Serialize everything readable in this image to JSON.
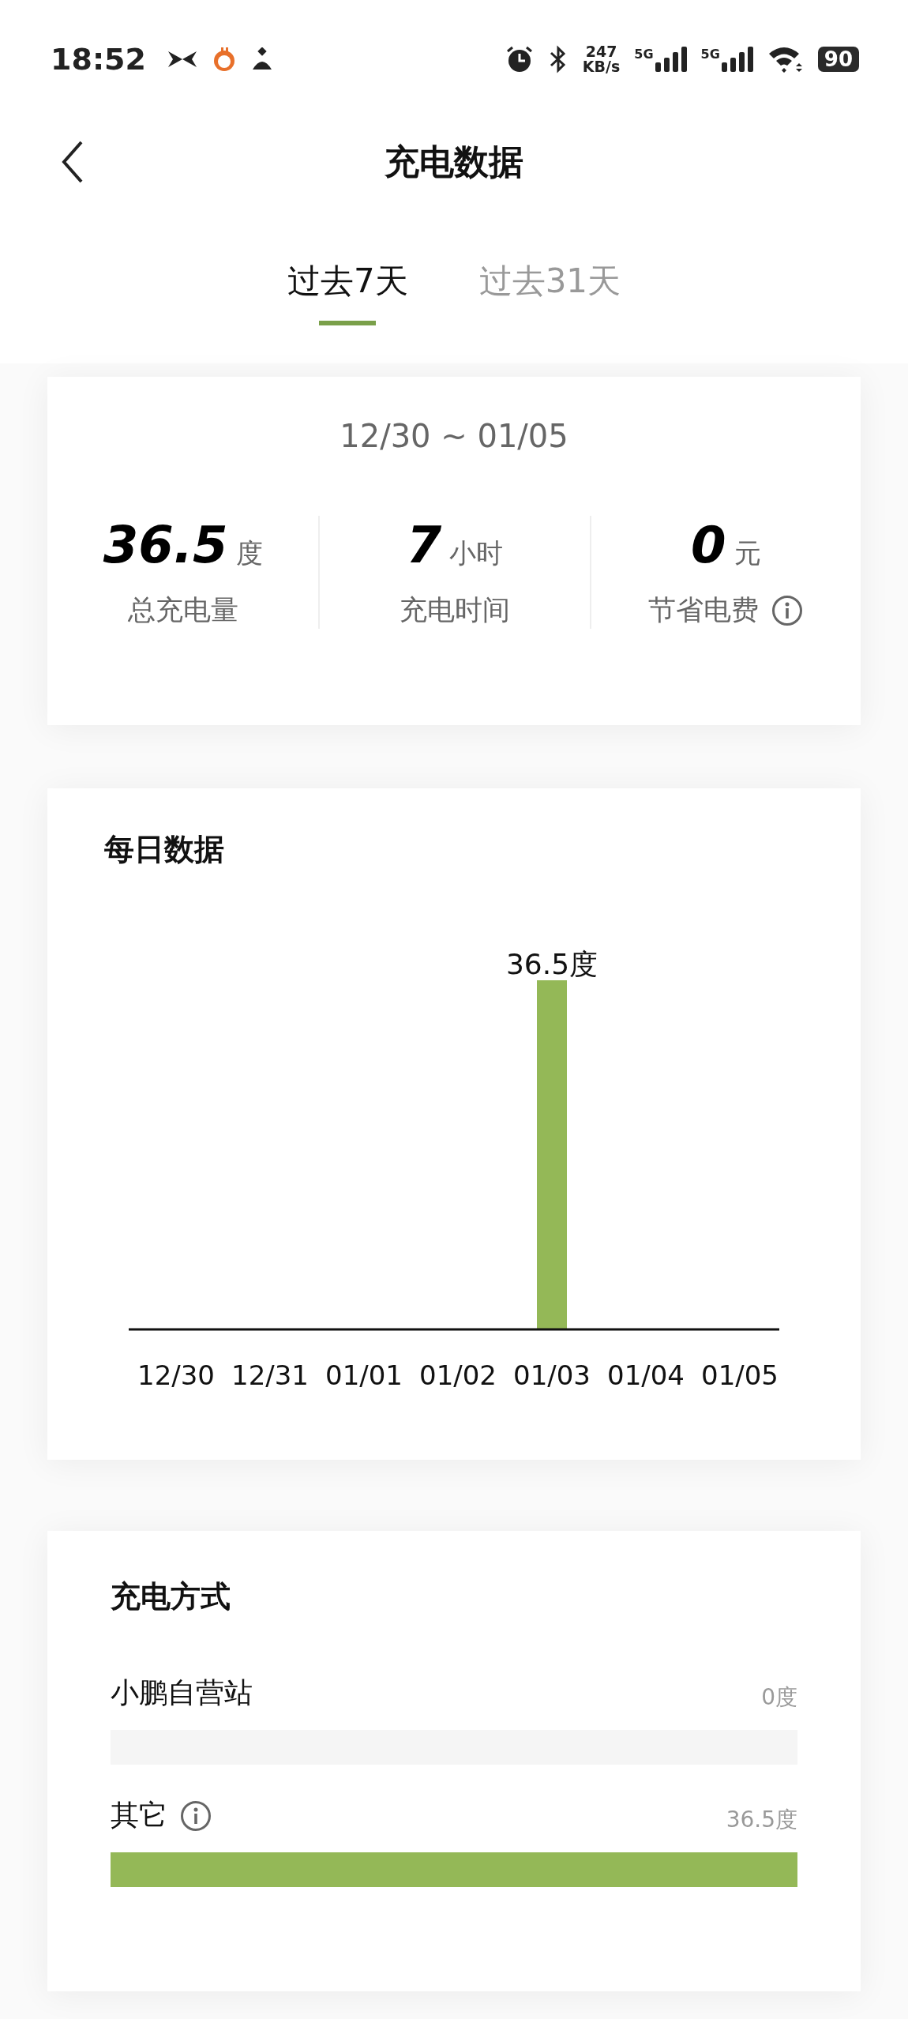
{
  "status_bar": {
    "time": "18:52",
    "speed_value": "247",
    "speed_unit": "KB/s",
    "networks": [
      "5G",
      "5G"
    ],
    "battery": "90"
  },
  "header": {
    "title": "充电数据"
  },
  "tabs": [
    {
      "label": "过去7天",
      "selected": true
    },
    {
      "label": "过去31天",
      "selected": false
    }
  ],
  "summary": {
    "date_range": "12/30 ~ 01/05",
    "stats": [
      {
        "value": "36.5",
        "unit": "度",
        "label": "总充电量",
        "info": false
      },
      {
        "value": "7",
        "unit": "小时",
        "label": "充电时间",
        "info": false
      },
      {
        "value": "0",
        "unit": "元",
        "label": "节省电费",
        "info": true
      }
    ]
  },
  "daily": {
    "title": "每日数据",
    "chart_data": {
      "type": "bar",
      "categories": [
        "12/30",
        "12/31",
        "01/01",
        "01/02",
        "01/03",
        "01/04",
        "01/05"
      ],
      "values": [
        0,
        0,
        0,
        0,
        36.5,
        0,
        0
      ],
      "value_labels": [
        null,
        null,
        null,
        null,
        "36.5度",
        null,
        null
      ],
      "ylim": [
        0,
        36.5
      ]
    }
  },
  "methods": {
    "title": "充电方式",
    "items": [
      {
        "label": "小鹏自营站",
        "info": false,
        "reading": "0度",
        "level": 0
      },
      {
        "label": "其它",
        "info": true,
        "reading": "36.5度",
        "level": 1
      }
    ]
  }
}
